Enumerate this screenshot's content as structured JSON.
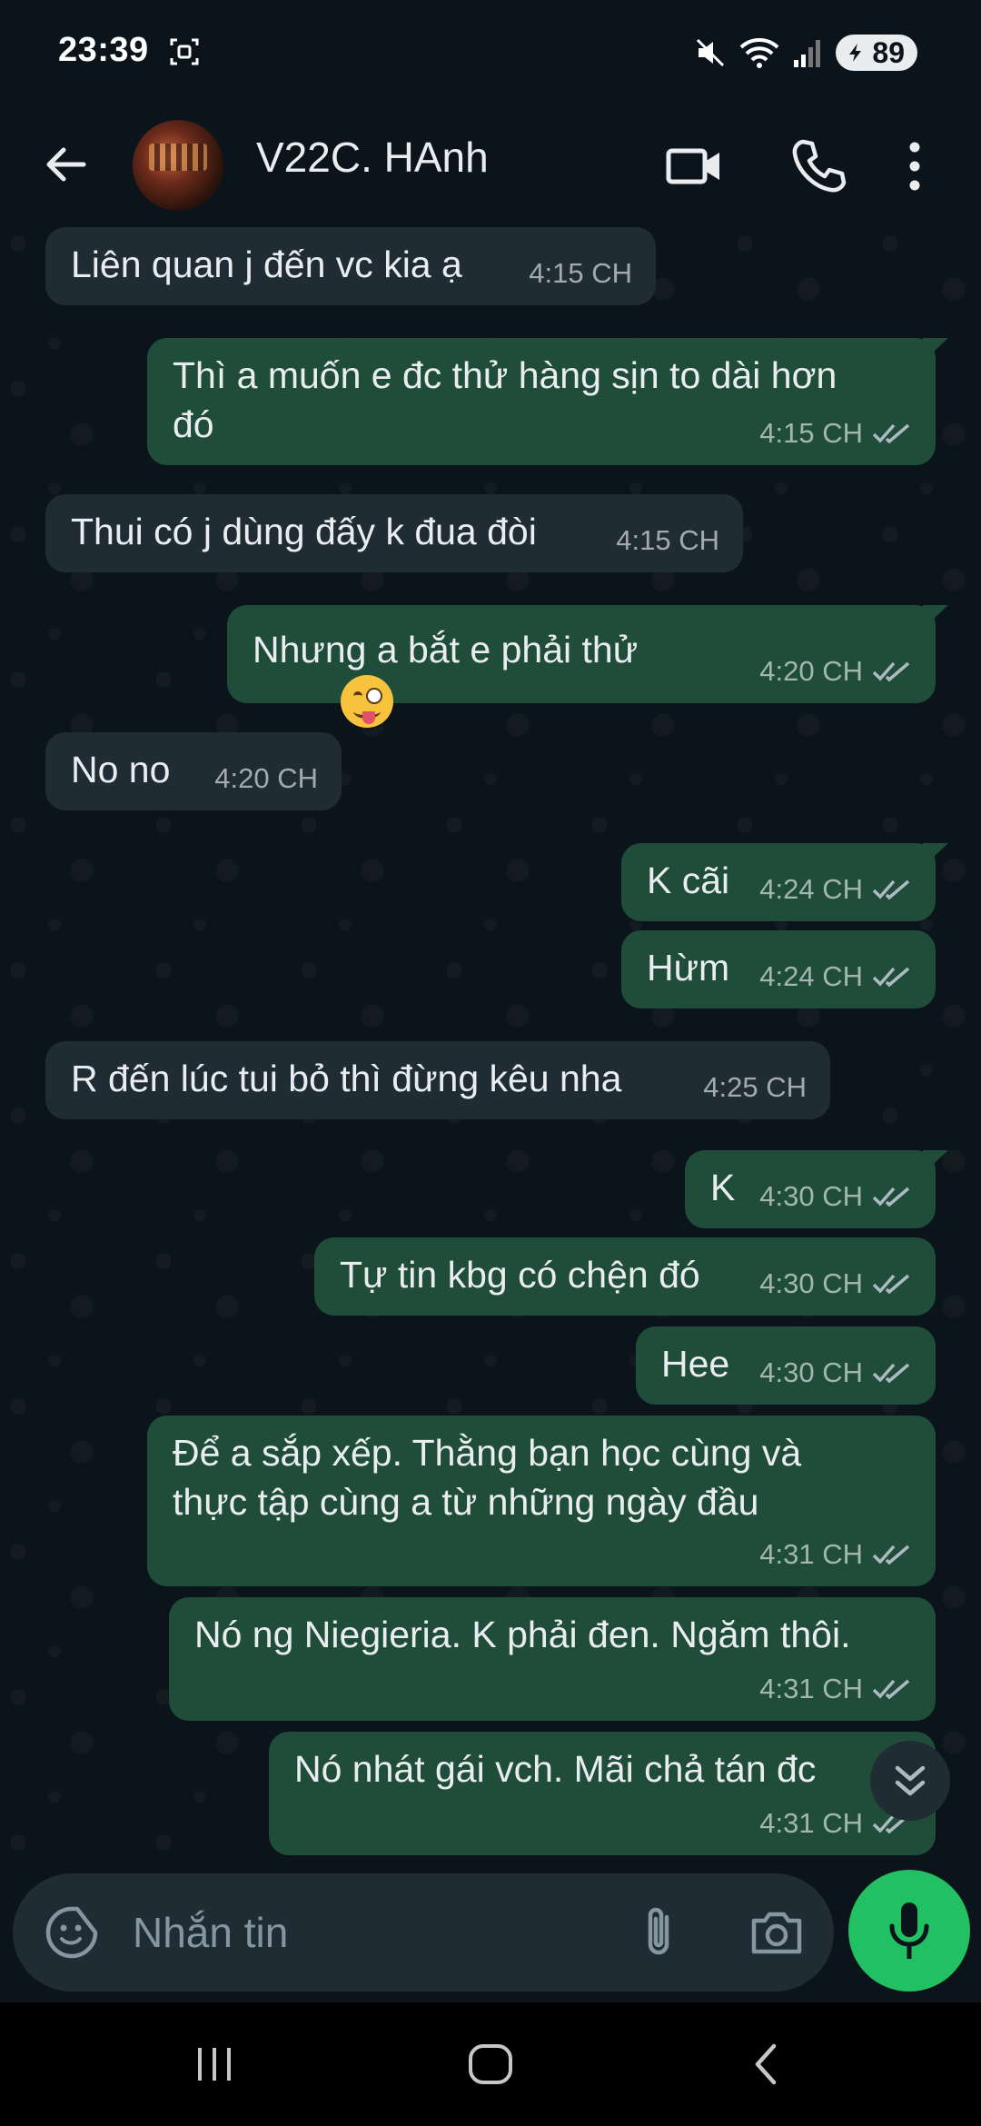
{
  "status_bar": {
    "time": "23:39",
    "battery": "89",
    "icons": [
      "screenshot-icon",
      "mute-icon",
      "wifi-icon",
      "signal-icon",
      "battery-icon"
    ]
  },
  "header": {
    "contact_name": "V22C. HAnh",
    "icons": [
      "back-arrow-icon",
      "video-call-icon",
      "voice-call-icon",
      "more-options-icon"
    ]
  },
  "messages": [
    {
      "dir": "in",
      "text": "Liên quan j đến vc kia ạ",
      "time": "4:15 CH"
    },
    {
      "dir": "out",
      "text": "Thì a muốn e đc thử hàng sịn to dài hơn\nđó",
      "time": "4:15 CH"
    },
    {
      "dir": "in",
      "text": "Thui có j dùng đấy k đua đòi",
      "time": "4:15 CH"
    },
    {
      "dir": "out",
      "text": "Nhưng a bắt e phải thử",
      "time": "4:20 CH",
      "emoji": "winking-face-with-tongue"
    },
    {
      "dir": "in",
      "text": "No no",
      "time": "4:20 CH"
    },
    {
      "dir": "out",
      "text": "K cãi",
      "time": "4:24 CH"
    },
    {
      "dir": "out",
      "text": "Hừm",
      "time": "4:24 CH"
    },
    {
      "dir": "in",
      "text": "R đến lúc tui bỏ thì đừng kêu nha",
      "time": "4:25 CH"
    },
    {
      "dir": "out",
      "text": "K",
      "time": "4:30 CH"
    },
    {
      "dir": "out",
      "text": "Tự tin kbg có chện đó",
      "time": "4:30 CH"
    },
    {
      "dir": "out",
      "text": "Hee",
      "time": "4:30 CH"
    },
    {
      "dir": "out",
      "text": "Để a sắp xếp. Thằng bạn học cùng và\nthực tập cùng a từ những ngày đầu",
      "time": "4:31 CH"
    },
    {
      "dir": "out",
      "text": "Nó ng Niegieria. K phải đen. Ngăm thôi.",
      "time": "4:31 CH"
    },
    {
      "dir": "out",
      "text": "Nó nhát gái vch. Mãi chả tán đc",
      "time": "4:31 CH"
    }
  ],
  "composer": {
    "placeholder": "Nhắn tin",
    "icons": [
      "emoji-sticker-icon",
      "attach-icon",
      "camera-icon",
      "mic-icon"
    ]
  },
  "colors": {
    "background": "#0b141a",
    "incoming_bubble": "#202c33",
    "outgoing_bubble": "#1f4d3a",
    "mic_button": "#21c063"
  }
}
